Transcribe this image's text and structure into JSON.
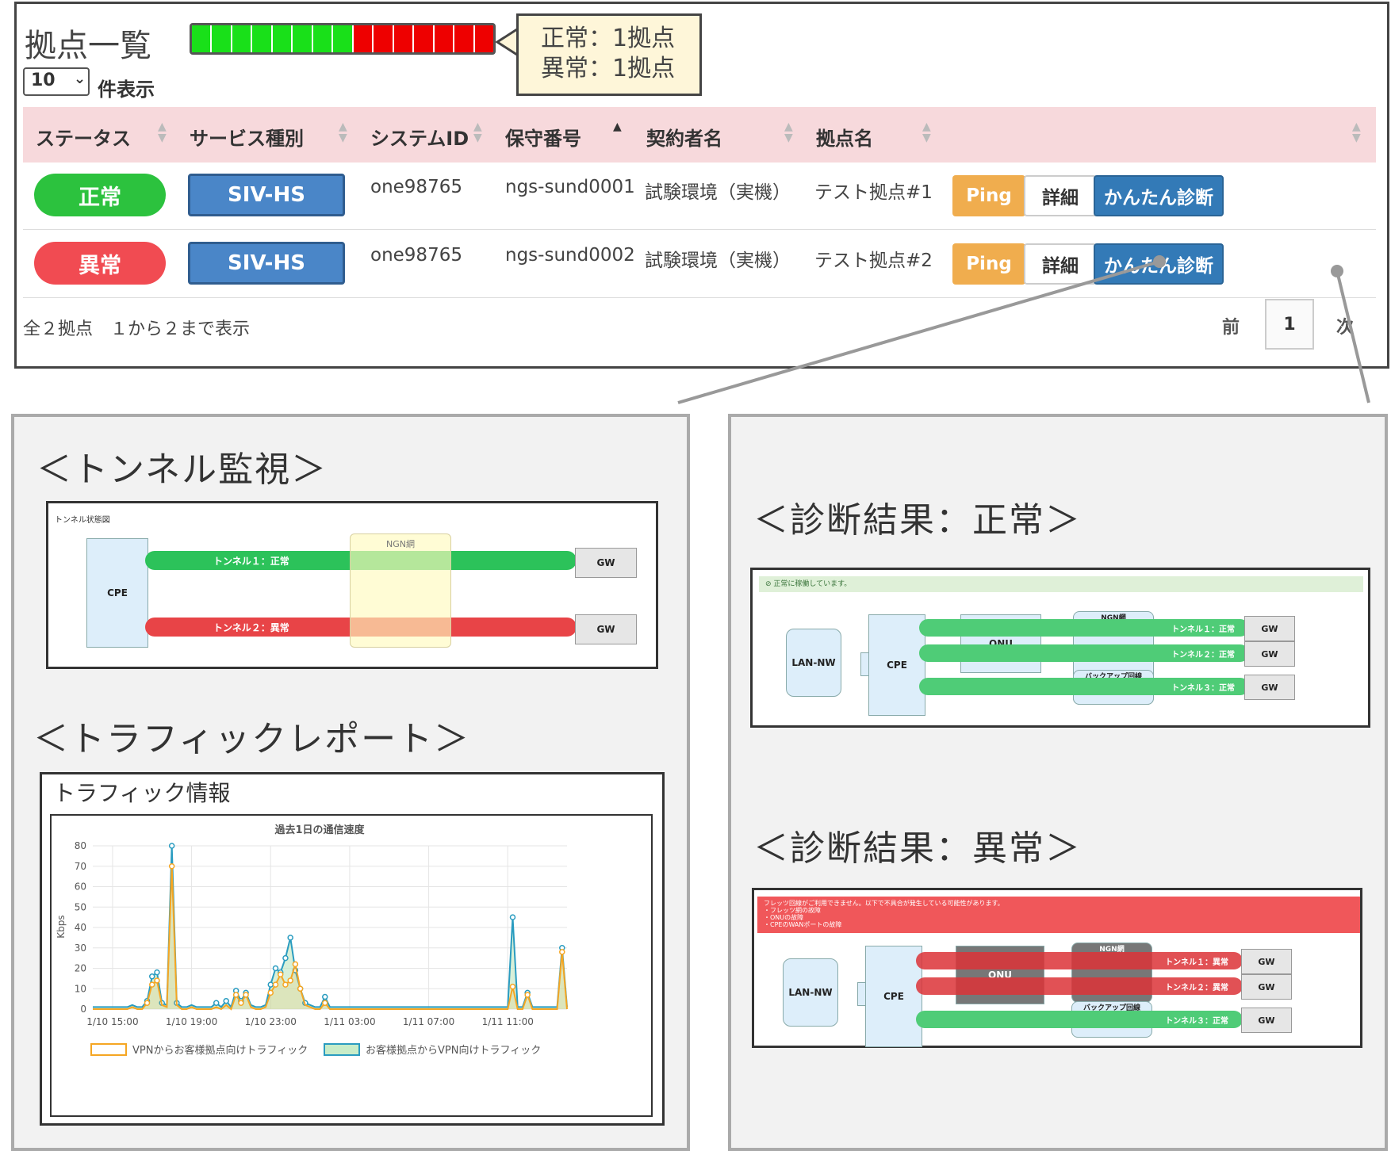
{
  "list": {
    "title": "拠点一覧",
    "status_segments": [
      "green",
      "green",
      "green",
      "green",
      "green",
      "green",
      "green",
      "green",
      "red",
      "red",
      "red",
      "red",
      "red",
      "red",
      "red"
    ],
    "callout": {
      "normal": "正常：1拠点",
      "error": "異常：1拠点"
    },
    "page_size": "10",
    "page_size_label": "件表示",
    "columns": [
      "ステータス",
      "サービス種別",
      "システムID",
      "保守番号",
      "契約者名",
      "拠点名"
    ],
    "rows": [
      {
        "status": "正常",
        "status_color": "#2cc23e",
        "service": "SIV-HS",
        "system_id": "one98765",
        "maintenance_no": "ngs-sund0001",
        "contractor": "試験環境（実機）",
        "site": "テスト拠点#1"
      },
      {
        "status": "異常",
        "status_color": "#f14b52",
        "service": "SIV-HS",
        "system_id": "one98765",
        "maintenance_no": "ngs-sund0002",
        "contractor": "試験環境（実機）",
        "site": "テスト拠点#2"
      }
    ],
    "buttons": {
      "ping": "Ping",
      "detail": "詳細",
      "diagnose": "かんたん診断"
    },
    "footer": "全２拠点　１から２まで表示",
    "pager": {
      "prev": "前",
      "page": "1",
      "next": "次"
    }
  },
  "tunnel": {
    "section_title": "＜トンネル監視＞",
    "diagram_title": "トンネル状態図",
    "cpe": "CPE",
    "ngn": "NGN網",
    "tunnel1": "トンネル１：正常",
    "tunnel2": "トンネル２：異常",
    "gw": "GW"
  },
  "traffic": {
    "section_title": "＜トラフィックレポート＞",
    "panel_title": "トラフィック情報"
  },
  "chart_data": {
    "type": "line",
    "title": "過去1日の通信速度",
    "ylabel": "Kbps",
    "ylim": [
      0,
      80
    ],
    "yticks": [
      0,
      10,
      20,
      30,
      40,
      50,
      60,
      70,
      80
    ],
    "xticks": [
      "1/10 15:00",
      "1/10 19:00",
      "1/10 23:00",
      "1/11 03:00",
      "1/11 07:00",
      "1/11 11:00"
    ],
    "x_hours": [
      0,
      1,
      2,
      3,
      4,
      5,
      6,
      7,
      8,
      9,
      10,
      11,
      12,
      13,
      14,
      15,
      16,
      17,
      18,
      19,
      20,
      21,
      22,
      23,
      24,
      25,
      26,
      27,
      28,
      29,
      30,
      31,
      32,
      33,
      34,
      35,
      36,
      37,
      38,
      39,
      40,
      41,
      42,
      43,
      44,
      45,
      46,
      47,
      48,
      49,
      50,
      51,
      52,
      53,
      54,
      55,
      56,
      57,
      58,
      59,
      60,
      61,
      62,
      63,
      64,
      65,
      66,
      67,
      68,
      69,
      70,
      71,
      72,
      73,
      74,
      75,
      76,
      77,
      78,
      79,
      80,
      81,
      82,
      83,
      84,
      85,
      86,
      87,
      88,
      89,
      90,
      91,
      92,
      93,
      94,
      95,
      96
    ],
    "series": [
      {
        "name": "VPNからお客様拠点向けトラフィック",
        "color": "#f5a623",
        "values": [
          0,
          0,
          0,
          0,
          0,
          0,
          0,
          0,
          1,
          0,
          0,
          3,
          12,
          14,
          2,
          1,
          70,
          2,
          0,
          0,
          1,
          0,
          0,
          0,
          0,
          1,
          0,
          2,
          0,
          7,
          3,
          7,
          1,
          0,
          0,
          1,
          8,
          12,
          17,
          12,
          14,
          22,
          10,
          2,
          1,
          0,
          0,
          3,
          0,
          0,
          0,
          0,
          0,
          0,
          0,
          0,
          0,
          0,
          0,
          0,
          0,
          0,
          0,
          0,
          0,
          0,
          0,
          0,
          0,
          0,
          0,
          0,
          0,
          0,
          0,
          0,
          0,
          0,
          0,
          0,
          0,
          0,
          0,
          0,
          0,
          0,
          0,
          0,
          0,
          0,
          0,
          0,
          0,
          0,
          0,
          0,
          0
        ]
      },
      {
        "name": "お客様拠点からVPN向けトラフィック",
        "color": "#2a9cc0",
        "values": [
          1,
          1,
          1,
          1,
          1,
          1,
          1,
          1,
          2,
          1,
          1,
          4,
          16,
          18,
          3,
          2,
          80,
          3,
          1,
          1,
          2,
          1,
          1,
          1,
          1,
          3,
          1,
          4,
          1,
          9,
          4,
          8,
          2,
          1,
          1,
          2,
          12,
          20,
          18,
          25,
          35,
          19,
          10,
          3,
          2,
          1,
          1,
          6,
          1,
          1,
          1,
          1,
          1,
          1,
          1,
          1,
          1,
          1,
          1,
          1,
          1,
          1,
          1,
          1,
          1,
          1,
          1,
          1,
          1,
          1,
          1,
          1,
          1,
          1,
          1,
          1,
          1,
          1,
          1,
          1,
          1,
          1,
          1,
          1,
          1,
          1,
          1,
          1,
          1,
          1,
          1,
          1,
          1,
          1,
          1,
          1,
          1
        ]
      }
    ],
    "late_spikes": [
      {
        "hour": 85,
        "vpn_to_site": 11,
        "site_to_vpn": 45
      },
      {
        "hour": 88,
        "vpn_to_site": 7,
        "site_to_vpn": 8
      },
      {
        "hour": 95,
        "vpn_to_site": 28,
        "site_to_vpn": 30
      }
    ]
  },
  "diag_ok": {
    "section_title": "＜診断結果：正常＞",
    "banner": "⊘ 正常に稼働しています。",
    "lan": "LAN-NW",
    "cpe": "CPE",
    "onu": "ONU",
    "ngn": "NGN網",
    "backup": "バックアップ回線",
    "tunnel1": "トンネル１：正常",
    "tunnel2": "トンネル２：正常",
    "tunnel3": "トンネル３：正常",
    "gw": "GW"
  },
  "diag_err": {
    "section_title": "＜診断結果：異常＞",
    "banner_line1": "フレッツ回線がご利用できません。以下で不具合が発生している可能性があります。",
    "banner_line2": "・フレッツ網の故障",
    "banner_line3": "・ONUの故障",
    "banner_line4": "・CPEのWANポートの故障",
    "lan": "LAN-NW",
    "cpe": "CPE",
    "onu": "ONU",
    "ngn": "NGN網",
    "backup": "バックアップ回線",
    "tunnel1": "トンネル１：異常",
    "tunnel2": "トンネル２：異常",
    "tunnel3": "トンネル３：正常",
    "gw": "GW"
  }
}
